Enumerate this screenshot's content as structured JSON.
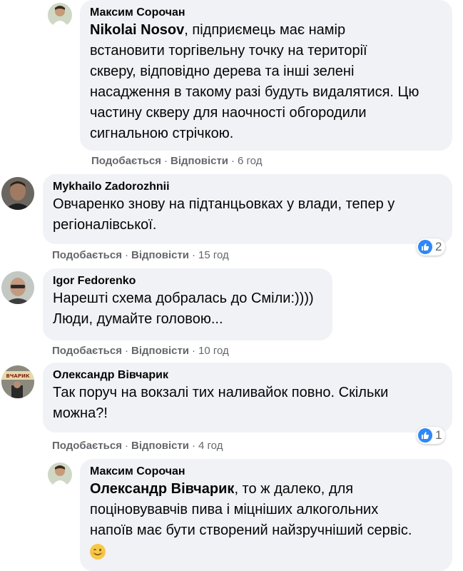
{
  "comments": [
    {
      "author": "Максим Сорочан",
      "mention": "Nikolai Nosov",
      "lines": [
        ", підприємець має намір",
        "встановити торгівельну точку на території",
        "скверу, відповідно дерева та інші зелені",
        "насадження в такому разі будуть видалятися. Цю",
        "частину скверу для наочності обгородили",
        "сигнальною стрічкою."
      ],
      "like_label": "Подобається",
      "reply_label": "Відповісти",
      "time": "6 год"
    },
    {
      "author": "Mykhailo Zadorozhnii",
      "lines": [
        "Овчаренко знову на підтанцьовках у влади, тепер у",
        "регіоналівської."
      ],
      "like_label": "Подобається",
      "reply_label": "Відповісти",
      "time": "15 год",
      "reaction_count": "2"
    },
    {
      "author": "Igor Fedorenko",
      "lines": [
        "Нарешті схема добралась до Сміли:))))",
        "Люди, думайте головою..."
      ],
      "like_label": "Подобається",
      "reply_label": "Відповісти",
      "time": "10 год"
    },
    {
      "author": "Олександр Вівчарик",
      "lines": [
        "Так поруч на вокзалі тих наливайок повно. Скільки",
        "можна?!"
      ],
      "like_label": "Подобається",
      "reply_label": "Відповісти",
      "time": "4 год",
      "reaction_count": "1",
      "avatar_sign": "ВЧАРИК"
    },
    {
      "author": "Максим Сорочан",
      "mention": "Олександр Вівчарик",
      "lines": [
        ", то ж далеко, для",
        "поціновувавчів пива і міцніших алкогольних",
        "напоїв має бути створений найзручніший сервіс."
      ],
      "emoji": "winking-face"
    }
  ],
  "separator": "·",
  "colors": {
    "bubble": "#f0f2f5",
    "meta_text": "#65676b",
    "like_blue": "#2d88ff"
  }
}
